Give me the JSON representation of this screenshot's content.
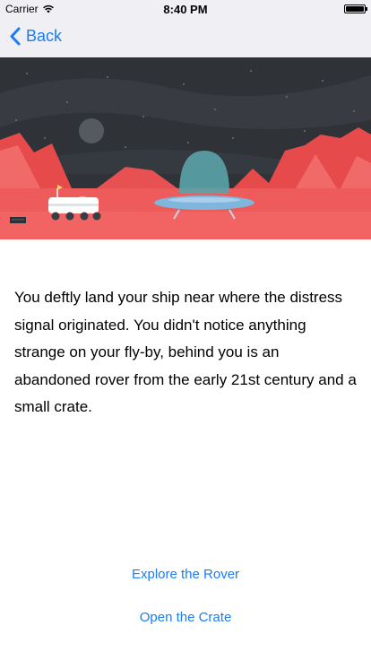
{
  "status_bar": {
    "carrier": "Carrier",
    "time": "8:40 PM"
  },
  "nav": {
    "back_label": "Back"
  },
  "story": {
    "text": "You deftly land your ship near where the distress signal originated. You didn't notice anything strange on your fly-by, behind you is an abandoned rover from the early 21st century and a small crate."
  },
  "choices": [
    {
      "label": "Explore the Rover"
    },
    {
      "label": "Open the Crate"
    }
  ],
  "colors": {
    "accent": "#1a7cf6",
    "sky": "#2f3338",
    "ground": "#ee5b5b"
  }
}
